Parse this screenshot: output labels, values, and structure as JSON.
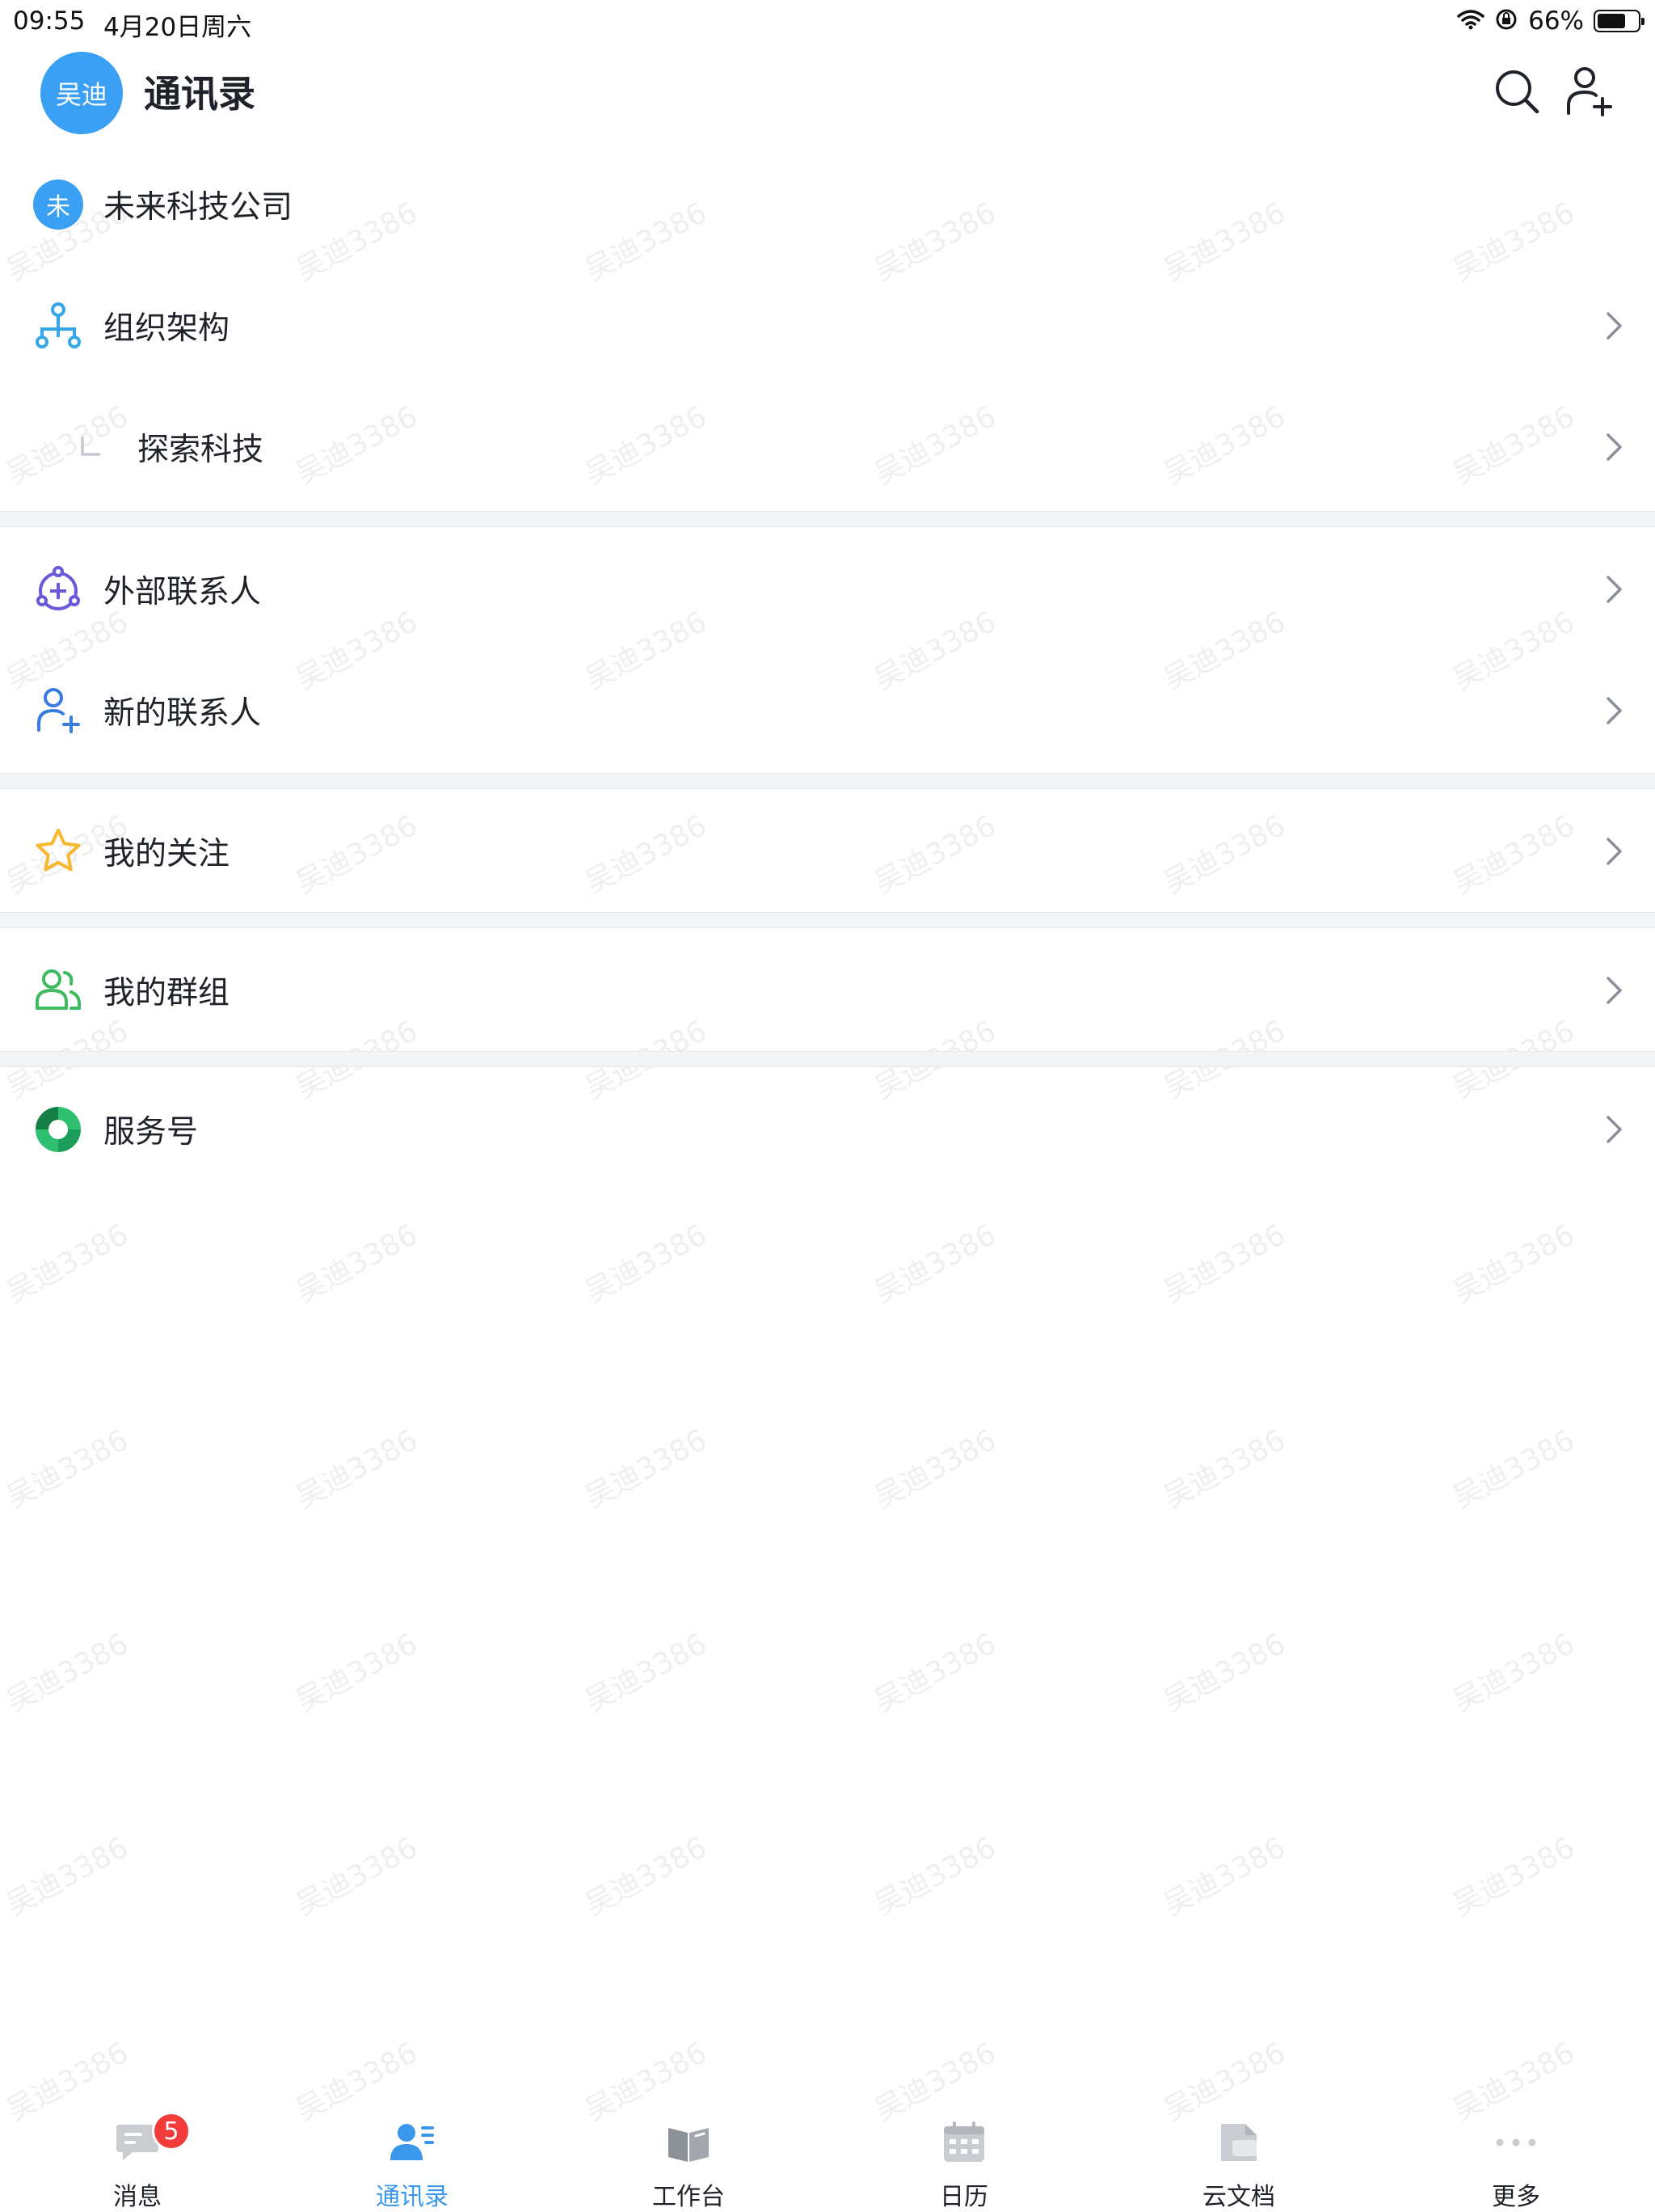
{
  "status_bar": {
    "time": "09:55",
    "date": "4月20日周六",
    "battery": "66%"
  },
  "header": {
    "avatar_text": "吴迪",
    "title": "通讯录"
  },
  "company": {
    "badge": "未",
    "name": "未来科技公司"
  },
  "list": {
    "org": "组织架构",
    "sub_org": "探索科技",
    "external_contacts": "外部联系人",
    "new_contacts": "新的联系人",
    "following": "我的关注",
    "groups": "我的群组",
    "service_accounts": "服务号"
  },
  "watermark": "吴迪3386",
  "tabs": [
    {
      "label": "消息",
      "icon": "message-icon",
      "badge": "5"
    },
    {
      "label": "通讯录",
      "icon": "contacts-icon",
      "active": true
    },
    {
      "label": "工作台",
      "icon": "workspace-icon"
    },
    {
      "label": "日历",
      "icon": "calendar-icon"
    },
    {
      "label": "云文档",
      "icon": "cloud-doc-icon"
    },
    {
      "label": "更多",
      "icon": "more-icon"
    }
  ],
  "colors": {
    "accent": "#3a97ec",
    "avatar": "#3aa0f4",
    "badge": "#f23c3c",
    "star": "#f5b82e",
    "group": "#3dbb5e",
    "external": "#6a5ad8"
  }
}
